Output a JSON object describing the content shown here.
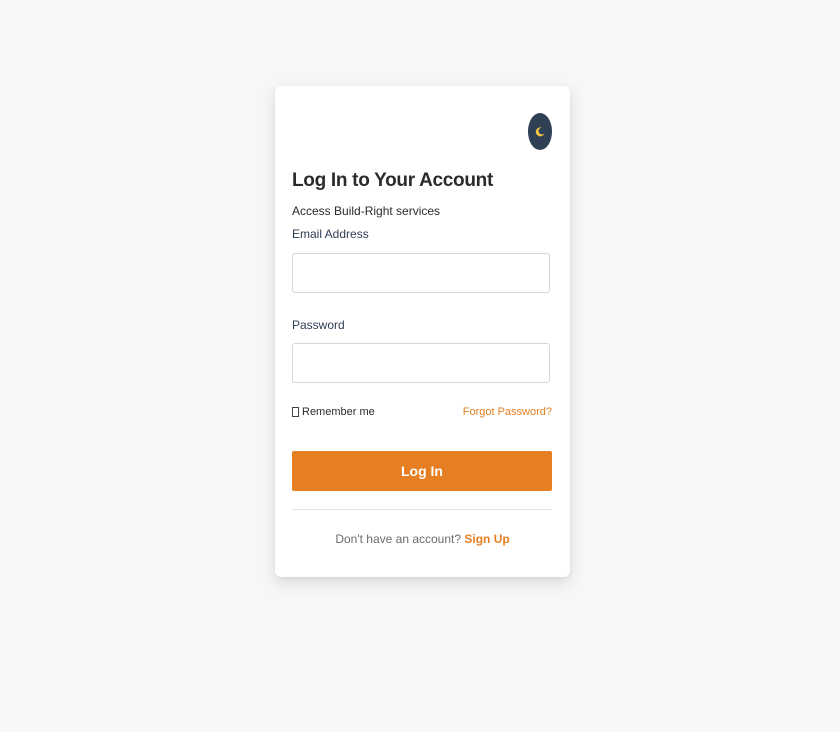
{
  "login": {
    "title": "Log In to Your Account",
    "subtitle": "Access Build-Right services",
    "email_label": "Email Address",
    "email_value": "",
    "password_label": "Password",
    "password_value": "",
    "remember_label": "Remember me",
    "remember_checked": false,
    "forgot_label": "Forgot Password?",
    "submit_label": "Log In",
    "signup_prompt": "Don't have an account?",
    "signup_label": "Sign Up"
  },
  "theme_toggle": {
    "icon": "moon-icon"
  },
  "colors": {
    "accent": "#e67e22",
    "toggle_bg": "#2f4055",
    "page_bg": "#f7f7f5",
    "card_bg": "#ffffff"
  }
}
